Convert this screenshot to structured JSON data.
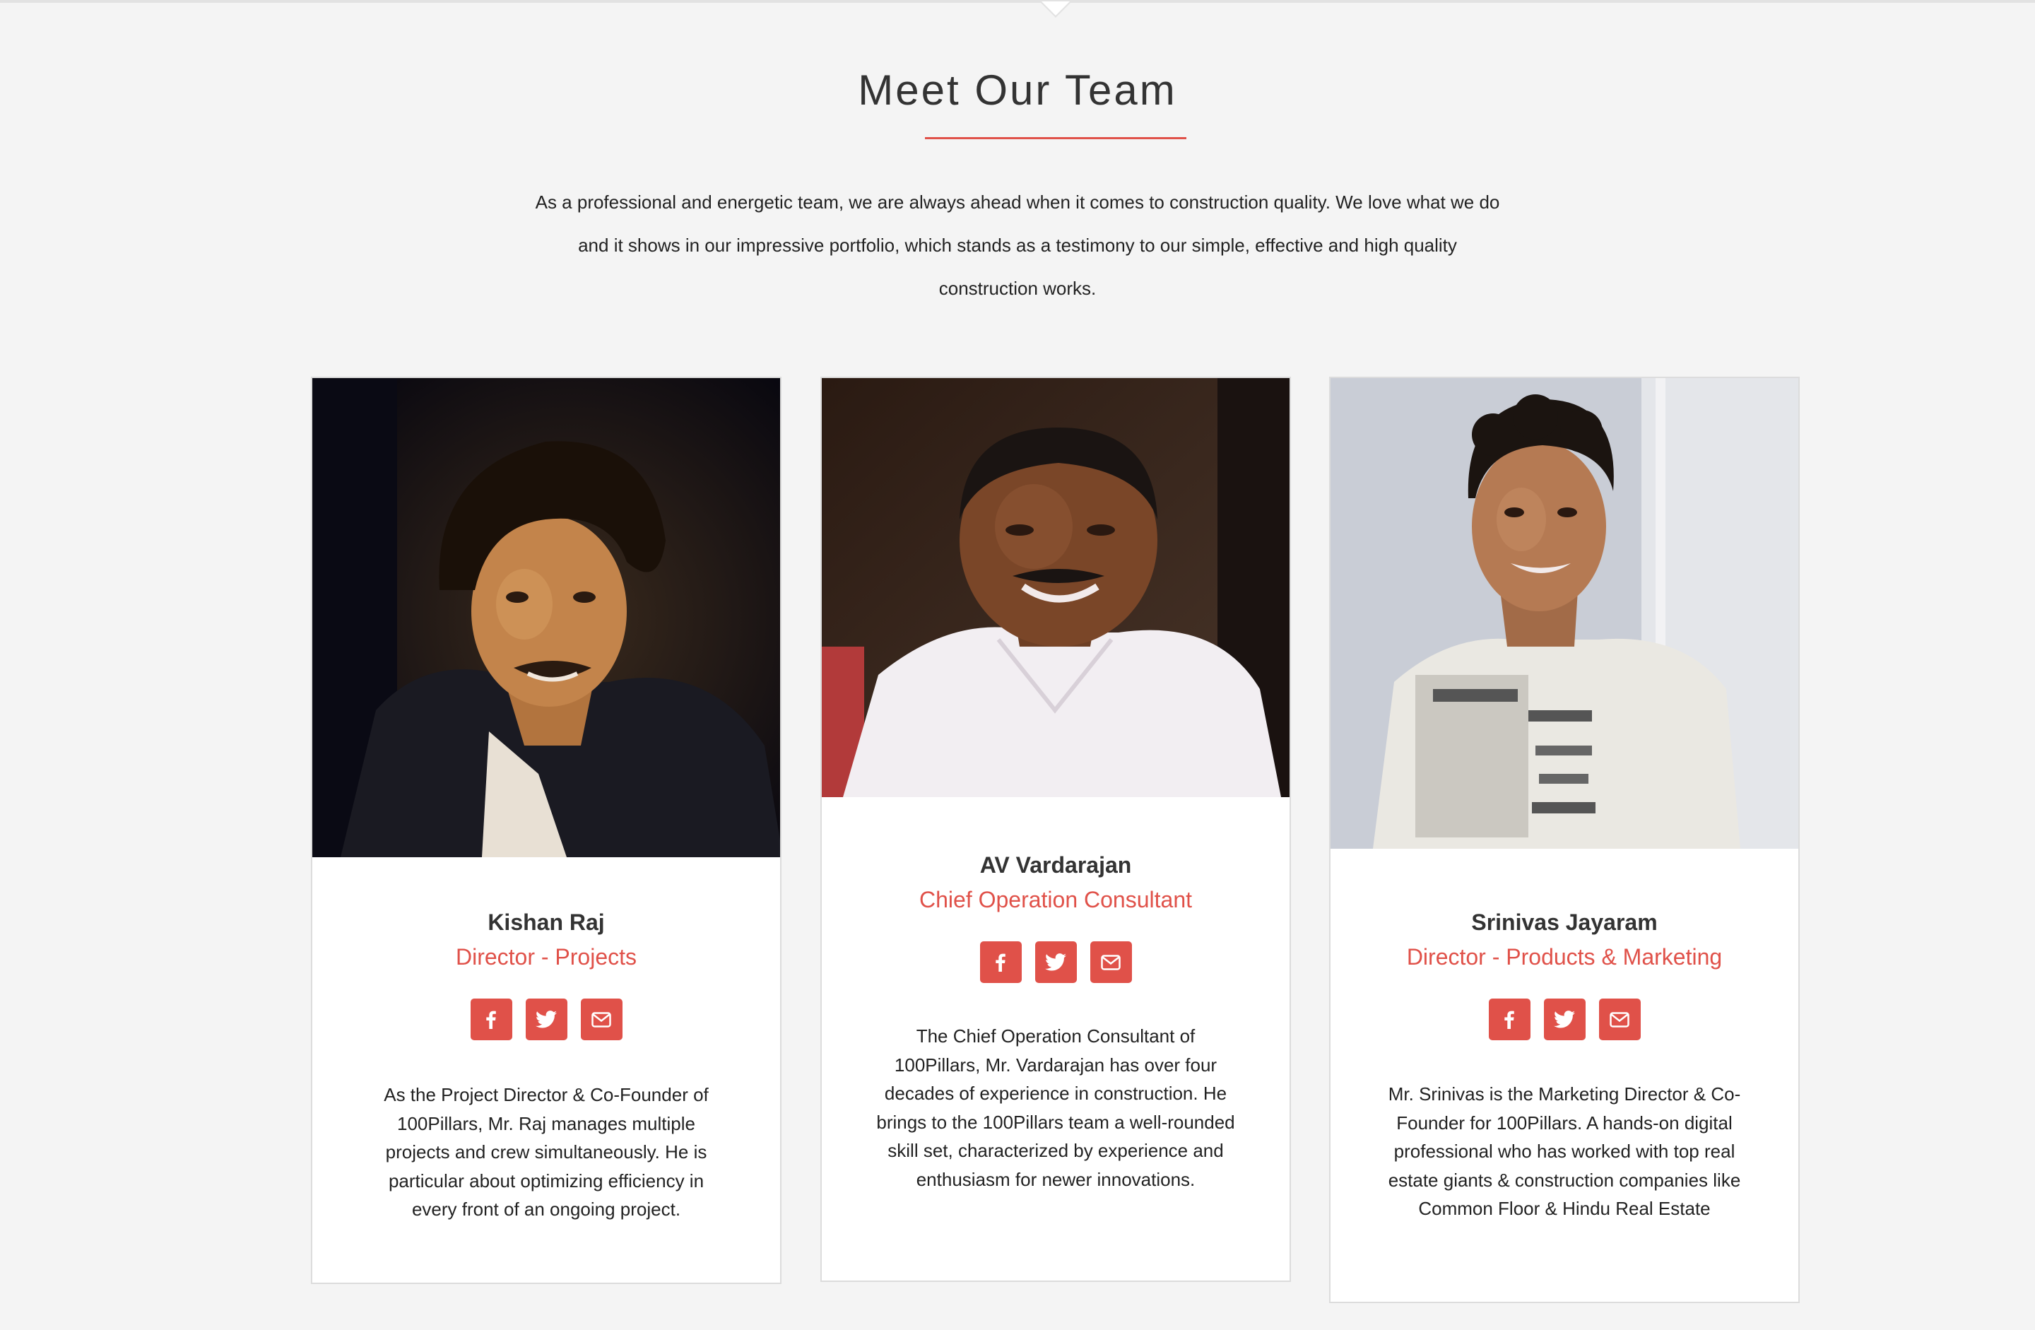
{
  "section": {
    "title": "Meet Our Team",
    "intro": "As a professional and energetic team, we are always ahead when it comes to construction quality. We love what we do and it shows in our impressive portfolio, which stands as a testimony to our simple, effective and high quality construction works."
  },
  "colors": {
    "accent": "#e05149",
    "background": "#f4f4f4",
    "card": "#ffffff",
    "text": "#222222"
  },
  "icons": {
    "facebook": "facebook-icon",
    "twitter": "twitter-icon",
    "email": "envelope-icon"
  },
  "team": [
    {
      "name": "Kishan Raj",
      "role": "Director - Projects",
      "bio": "As the Project Director & Co-Founder of 100Pillars, Mr. Raj manages multiple projects and crew simultaneously. He is particular about optimizing efficiency in every front of an ongoing project."
    },
    {
      "name": "AV Vardarajan",
      "role": "Chief Operation Consultant",
      "bio": "The Chief Operation Consultant of 100Pillars, Mr. Vardarajan has over four decades of experience in construction. He brings to the 100Pillars team a well-rounded skill set, characterized by experience and enthusiasm for newer innovations."
    },
    {
      "name": "Srinivas Jayaram",
      "role": "Director - Products & Marketing",
      "bio": "Mr. Srinivas is the Marketing Director & Co-Founder for 100Pillars. A hands-on digital professional who has worked with top real estate giants & construction companies like Common Floor & Hindu Real Estate"
    }
  ]
}
